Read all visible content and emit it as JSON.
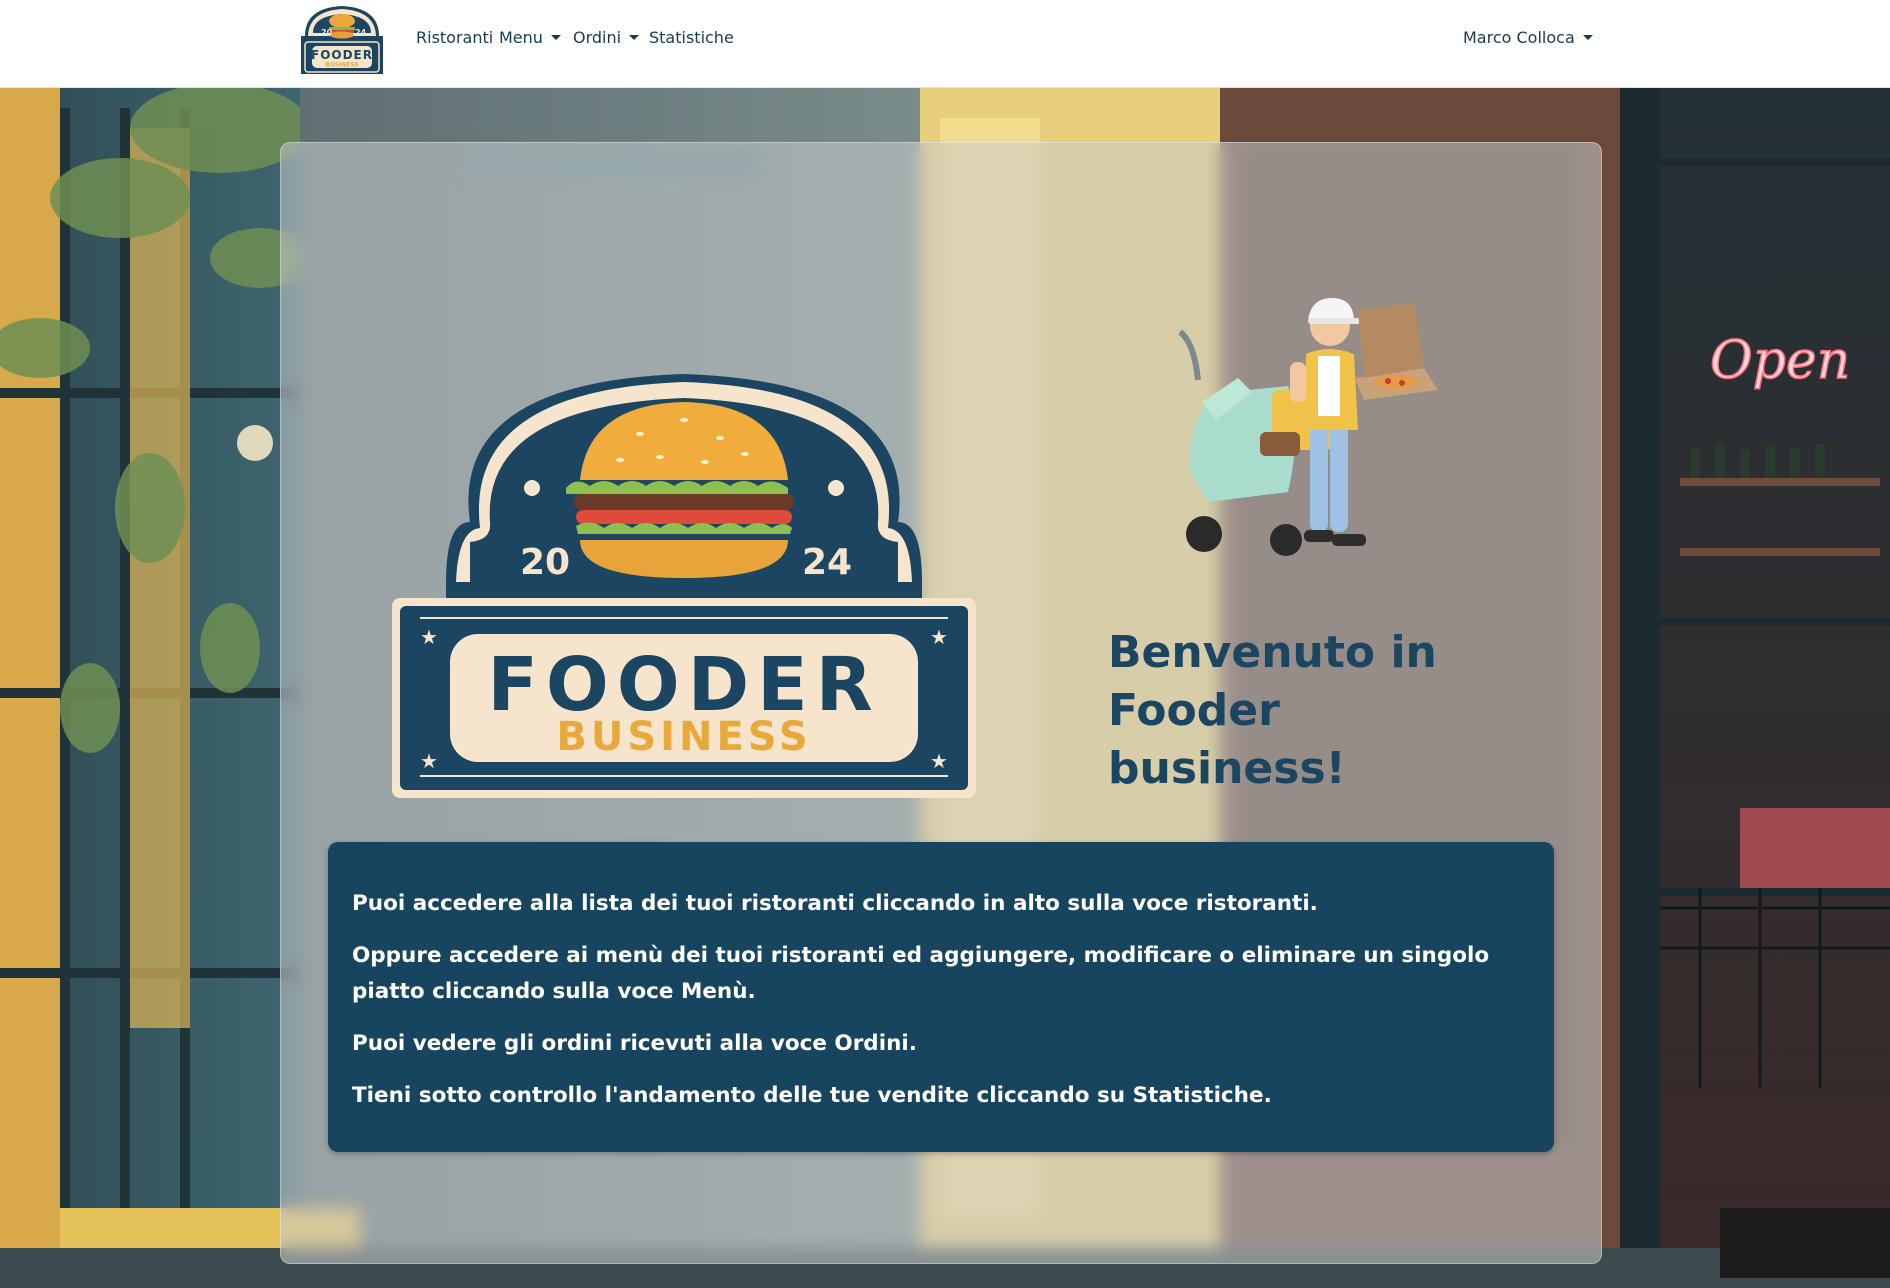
{
  "navbar": {
    "brand": {
      "year_left": "20",
      "year_right": "24",
      "title": "FOODER",
      "subtitle": "BUSINESS"
    },
    "links": [
      {
        "label": "Ristoranti",
        "dropdown": false
      },
      {
        "label": "Menu",
        "dropdown": true
      },
      {
        "label": "Ordini",
        "dropdown": true
      },
      {
        "label": "Statistiche",
        "dropdown": false
      }
    ],
    "user": {
      "label": "Marco Colloca",
      "dropdown": true
    }
  },
  "scene": {
    "neon_sign": "Open"
  },
  "hero": {
    "logo": {
      "year_left": "20",
      "year_right": "24",
      "title": "FOODER",
      "subtitle": "BUSINESS"
    },
    "illustration": "delivery-rider-scooter-pizza",
    "welcome_title": "Benvenuto in Fooder business!"
  },
  "info": {
    "paragraphs": [
      "Puoi accedere alla lista dei tuoi ristoranti cliccando in alto sulla voce ristoranti.",
      "Oppure accedere ai menù dei tuoi ristoranti ed aggiungere, modificare o eliminare un singolo piatto cliccando sulla voce Menù.",
      "Puoi vedere gli ordini ricevuti alla voce Ordini.",
      "Tieni sotto controllo l'andamento delle tue vendite cliccando su Statistiche."
    ]
  },
  "colors": {
    "navy": "#1b4560",
    "panel": "#17455f",
    "cream": "#f6e4cc",
    "gold": "#e8a93a",
    "nav_text": "#1b3a4f"
  }
}
